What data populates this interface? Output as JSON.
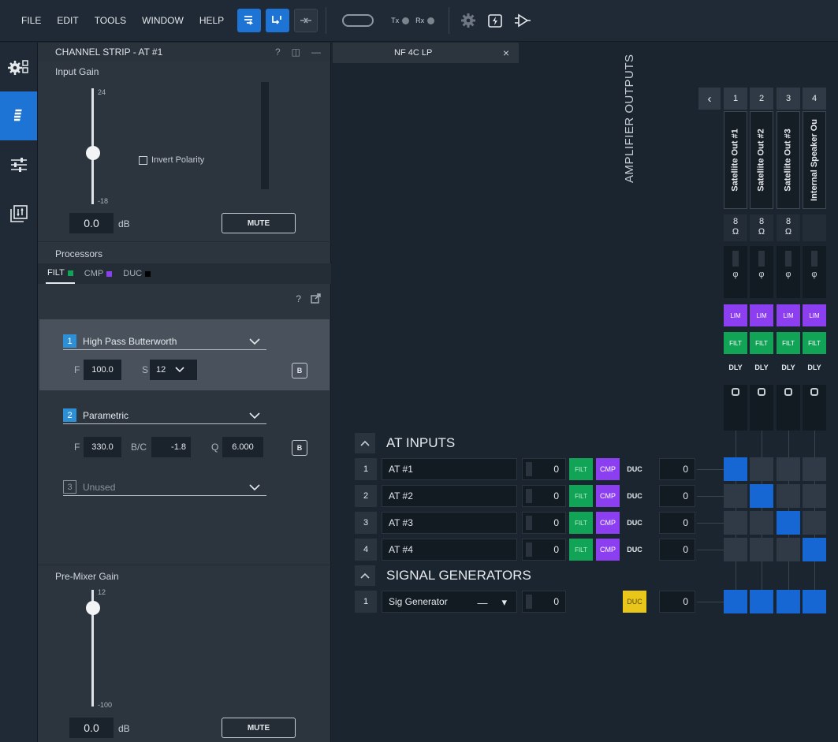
{
  "menu": [
    "FILE",
    "EDIT",
    "TOOLS",
    "WINDOW",
    "HELP"
  ],
  "toolbar": {
    "tx_label": "Tx",
    "rx_label": "Rx"
  },
  "channel_strip": {
    "title": "CHANNEL STRIP - AT #1",
    "help": "?",
    "input_gain": {
      "label": "Input Gain",
      "max": "24",
      "min": "-18",
      "value": "0.0",
      "unit": "dB",
      "invert_polarity": "Invert Polarity",
      "mute": "MUTE"
    },
    "processors": {
      "label": "Processors",
      "tabs": [
        {
          "label": "FILT",
          "color": "#12a456"
        },
        {
          "label": "CMP",
          "color": "#8b3ff0"
        },
        {
          "label": "DUC",
          "color": "#000000"
        }
      ],
      "help": "?"
    },
    "bands": [
      {
        "num": "1",
        "type": "High Pass Butterworth",
        "f_label": "F",
        "f": "100.0",
        "s_label": "S",
        "s": "12",
        "b": "B"
      },
      {
        "num": "2",
        "type": "Parametric",
        "f_label": "F",
        "f": "330.0",
        "bc_label": "B/C",
        "bc": "-1.8",
        "q_label": "Q",
        "q": "6.000",
        "b": "B"
      },
      {
        "num": "3",
        "type": "Unused"
      }
    ],
    "pre_mixer_gain": {
      "label": "Pre-Mixer Gain",
      "max": "12",
      "min": "-100",
      "value": "0.0",
      "unit": "dB",
      "mute": "MUTE"
    }
  },
  "doc_tab": {
    "title": "NF 4C LP",
    "close": "×"
  },
  "amplifier_outputs": {
    "label": "AMPLIFIER OUTPUTS",
    "prev": "‹",
    "outputs": [
      {
        "num": "1",
        "name": "Satellite Out #1",
        "ohm": "8",
        "ohm_unit": "Ω"
      },
      {
        "num": "2",
        "name": "Satellite Out #2",
        "ohm": "8",
        "ohm_unit": "Ω"
      },
      {
        "num": "3",
        "name": "Satellite Out #3",
        "ohm": "8",
        "ohm_unit": "Ω"
      },
      {
        "num": "4",
        "name": "Internal Speaker Ou",
        "ohm": "",
        "ohm_unit": ""
      }
    ],
    "phase": "φ",
    "lim": "LIM",
    "filt": "FILT",
    "dly": "DLY"
  },
  "at_inputs": {
    "title": "AT INPUTS",
    "rows": [
      {
        "num": "1",
        "name": "AT #1",
        "gain": "0",
        "filt": "FILT",
        "cmp": "CMP",
        "duc": "DUC",
        "post": "0",
        "route": [
          1,
          0,
          0,
          0
        ]
      },
      {
        "num": "2",
        "name": "AT #2",
        "gain": "0",
        "filt": "FILT",
        "cmp": "CMP",
        "duc": "DUC",
        "post": "0",
        "route": [
          0,
          1,
          0,
          0
        ]
      },
      {
        "num": "3",
        "name": "AT #3",
        "gain": "0",
        "filt": "FILT",
        "cmp": "CMP",
        "duc": "DUC",
        "post": "0",
        "route": [
          0,
          0,
          1,
          0
        ]
      },
      {
        "num": "4",
        "name": "AT #4",
        "gain": "0",
        "filt": "FILT",
        "cmp": "CMP",
        "duc": "DUC",
        "post": "0",
        "route": [
          0,
          0,
          0,
          1
        ]
      }
    ]
  },
  "signal_generators": {
    "title": "SIGNAL GENERATORS",
    "rows": [
      {
        "num": "1",
        "name": "Sig Generator",
        "dash": "—",
        "gain": "0",
        "duc": "DUC",
        "post": "0",
        "route": [
          1,
          1,
          1,
          1
        ]
      }
    ]
  }
}
